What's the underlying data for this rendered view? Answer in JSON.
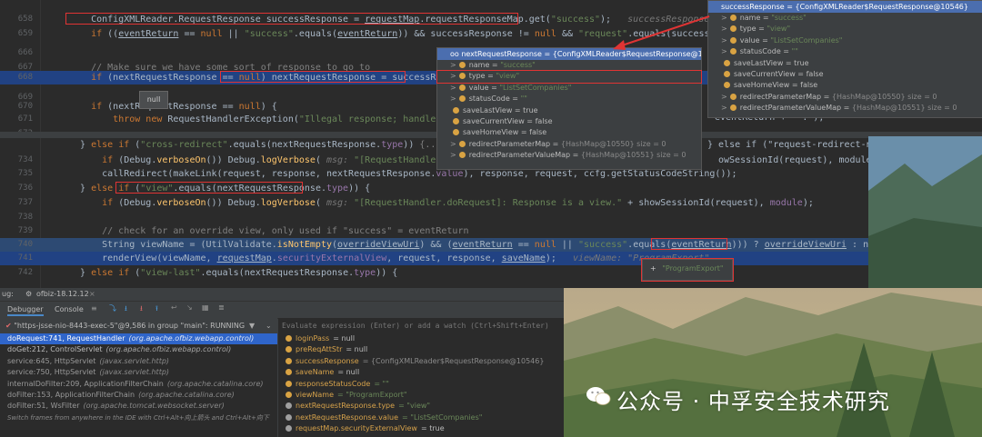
{
  "editor_top": {
    "lines": [
      {
        "n": "658",
        "segs": [
          {
            "t": "    ConfigXMLReader.RequestResponse successResponse = ",
            "c": ""
          },
          {
            "t": "requestMap",
            "c": "ul"
          },
          {
            "t": ".requestResponseMap.get(",
            "c": ""
          },
          {
            "t": "\"success\"",
            "c": "str"
          },
          {
            "t": ");",
            "c": ""
          },
          {
            "t": "   successResponse: ConfigXMLReader$Reque",
            "c": "hint"
          }
        ]
      },
      {
        "n": "659",
        "segs": [
          {
            "t": "    ",
            "c": ""
          },
          {
            "t": "if",
            "c": "kw"
          },
          {
            "t": " ((",
            "c": ""
          },
          {
            "t": "eventReturn",
            "c": "ul"
          },
          {
            "t": " == ",
            "c": ""
          },
          {
            "t": "null",
            "c": "kw"
          },
          {
            "t": " || ",
            "c": ""
          },
          {
            "t": "\"success\"",
            "c": "str"
          },
          {
            "t": ".equals(",
            "c": ""
          },
          {
            "t": "eventReturn",
            "c": "ul"
          },
          {
            "t": ")) && successResponse != ",
            "c": ""
          },
          {
            "t": "null",
            "c": "kw"
          },
          {
            "t": " && ",
            "c": ""
          },
          {
            "t": "\"request\"",
            "c": "str"
          },
          {
            "t": ".equals(successResponse.",
            "c": ""
          },
          {
            "t": "type",
            "c": "var"
          },
          {
            "t": ")) ",
            "c": ""
          },
          {
            "t": "{...}",
            "c": "cmt"
          }
        ]
      },
      {
        "n": "666",
        "segs": [
          {
            "t": "",
            "c": ""
          }
        ]
      },
      {
        "n": "667",
        "segs": [
          {
            "t": "    // Make sure we have some sort of response to go to",
            "c": "cmt"
          }
        ]
      },
      {
        "n": "668",
        "segs": [
          {
            "t": "    ",
            "c": ""
          },
          {
            "t": "if",
            "c": "kw"
          },
          {
            "t": " (nextRequestResponse == ",
            "c": ""
          },
          {
            "t": "null",
            "c": "kw"
          },
          {
            "t": ") nextRequestResponse = successResponse;",
            "c": ""
          }
        ]
      },
      {
        "n": "669",
        "segs": [
          {
            "t": "",
            "c": ""
          }
        ]
      },
      {
        "n": "670",
        "segs": [
          {
            "t": "    ",
            "c": ""
          },
          {
            "t": "if",
            "c": "kw"
          },
          {
            "t": " (nextRequestResponse == ",
            "c": ""
          },
          {
            "t": "null",
            "c": "kw"
          },
          {
            "t": ") {",
            "c": ""
          }
        ]
      },
      {
        "n": "671",
        "segs": [
          {
            "t": "        ",
            "c": ""
          },
          {
            "t": "throw new",
            "c": "kw"
          },
          {
            "t": " RequestHandlerException(",
            "c": ""
          },
          {
            "t": "\"Illegal response; handler could not pr",
            "c": "str"
          }
        ]
      },
      {
        "n": "672",
        "segs": [
          {
            "t": "",
            "c": ""
          }
        ]
      }
    ]
  },
  "editor_bottom": {
    "lines": [
      {
        "n": "",
        "segs": [
          {
            "t": "  } ",
            "c": ""
          },
          {
            "t": "else if",
            "c": "kw"
          },
          {
            "t": " (",
            "c": ""
          },
          {
            "t": "\"cross-redirect\"",
            "c": "str"
          },
          {
            "t": ".equals(nextRequestResponse.",
            "c": ""
          },
          {
            "t": "type",
            "c": "var"
          },
          {
            "t": ")) ",
            "c": ""
          },
          {
            "t": "{...}",
            "c": "cmt"
          },
          {
            "t": " ",
            "c": ""
          },
          {
            "t": "else if",
            "c": "kw"
          },
          {
            "t": " (",
            "c": ""
          }
        ]
      },
      {
        "n": "734",
        "segs": [
          {
            "t": "      ",
            "c": ""
          },
          {
            "t": "if",
            "c": "kw"
          },
          {
            "t": " (Debug.",
            "c": ""
          },
          {
            "t": "verboseOn",
            "c": "fn"
          },
          {
            "t": "()) Debug.",
            "c": ""
          },
          {
            "t": "logVerbose",
            "c": "fn"
          },
          {
            "t": "( ",
            "c": ""
          },
          {
            "t": "msg:",
            "c": "hint"
          },
          {
            "t": " \"[RequestHandler.doRequest]",
            "c": "str"
          }
        ]
      },
      {
        "n": "735",
        "segs": [
          {
            "t": "      callRedirect(makeLink(request, response, nextRequestResponse.",
            "c": ""
          },
          {
            "t": "value",
            "c": "var"
          },
          {
            "t": "), response, request, ccfg.getStatusCodeString());",
            "c": ""
          }
        ]
      },
      {
        "n": "736",
        "segs": [
          {
            "t": "  } ",
            "c": ""
          },
          {
            "t": "else if",
            "c": "kw"
          },
          {
            "t": " (",
            "c": ""
          },
          {
            "t": "\"view\"",
            "c": "str"
          },
          {
            "t": ".equals(nextRequestResponse.",
            "c": ""
          },
          {
            "t": "type",
            "c": "var"
          },
          {
            "t": ")) {",
            "c": ""
          }
        ]
      },
      {
        "n": "737",
        "segs": [
          {
            "t": "      ",
            "c": ""
          },
          {
            "t": "if",
            "c": "kw"
          },
          {
            "t": " (Debug.",
            "c": ""
          },
          {
            "t": "verboseOn",
            "c": "fn"
          },
          {
            "t": "()) Debug.",
            "c": ""
          },
          {
            "t": "logVerbose",
            "c": "fn"
          },
          {
            "t": "( ",
            "c": ""
          },
          {
            "t": "msg:",
            "c": "hint"
          },
          {
            "t": " \"[RequestHandler.doRequest]: Response is a view.\"",
            "c": "str"
          },
          {
            "t": " + showSessionId(request), ",
            "c": ""
          },
          {
            "t": "module",
            "c": "var"
          },
          {
            "t": ");",
            "c": ""
          }
        ]
      },
      {
        "n": "738",
        "segs": [
          {
            "t": "",
            "c": ""
          }
        ]
      },
      {
        "n": "739",
        "segs": [
          {
            "t": "      // check for an override view, only used if \"success\" = eventReturn",
            "c": "cmt"
          }
        ]
      },
      {
        "n": "740",
        "segs": [
          {
            "t": "      String viewName = (UtilValidate.",
            "c": ""
          },
          {
            "t": "isNotEmpty",
            "c": "fn"
          },
          {
            "t": "(",
            "c": ""
          },
          {
            "t": "overrideViewUri",
            "c": "ul"
          },
          {
            "t": ") && (",
            "c": ""
          },
          {
            "t": "eventReturn",
            "c": "ul"
          },
          {
            "t": " == ",
            "c": ""
          },
          {
            "t": "null",
            "c": "kw"
          },
          {
            "t": " || ",
            "c": ""
          },
          {
            "t": "\"success\"",
            "c": "str"
          },
          {
            "t": ".equals(",
            "c": ""
          },
          {
            "t": "eventReturn",
            "c": "ul"
          },
          {
            "t": "))) ? ",
            "c": ""
          },
          {
            "t": "overrideViewUri",
            "c": "ul"
          },
          {
            "t": " : nextRequestResponse.",
            "c": ""
          },
          {
            "t": "value",
            "c": "var"
          },
          {
            "t": ";",
            "c": ""
          }
        ]
      },
      {
        "n": "741",
        "segs": [
          {
            "t": "      renderView(viewName, ",
            "c": ""
          },
          {
            "t": "requestMap",
            "c": "ul"
          },
          {
            "t": ".",
            "c": ""
          },
          {
            "t": "securityExternalView",
            "c": "var"
          },
          {
            "t": ", request, response, ",
            "c": ""
          },
          {
            "t": "saveName",
            "c": "ul"
          },
          {
            "t": ");",
            "c": ""
          },
          {
            "t": "   viewName: \"ProgramExport\"",
            "c": "hint"
          }
        ]
      },
      {
        "n": "742",
        "segs": [
          {
            "t": "  } ",
            "c": ""
          },
          {
            "t": "else if",
            "c": "kw"
          },
          {
            "t": " (",
            "c": ""
          },
          {
            "t": "\"view-last\"",
            "c": "str"
          },
          {
            "t": ".equals(nextRequestResponse.",
            "c": ""
          },
          {
            "t": "type",
            "c": "var"
          },
          {
            "t": ")) {",
            "c": ""
          }
        ]
      }
    ],
    "right_overflow_1": "} else if (\"request-redirect-noparam",
    "right_overflow_2": "owSessionId(request), module);",
    "right_overflow_top": "eventReturn + \"\".\");"
  },
  "null_tooltip": "null",
  "popup_mid": {
    "title": "oo nextRequestResponse = {ConfigXMLReader$RequestResponse@10546}",
    "rows": [
      {
        "k": "name",
        "v": "\"success\"",
        "style": "grn",
        "arrow": ">"
      },
      {
        "k": "type",
        "v": "\"view\"",
        "style": "grn",
        "arrow": ">"
      },
      {
        "k": "value",
        "v": "\"ListSetCompanies\"",
        "style": "grn",
        "arrow": ">"
      },
      {
        "k": "statusCode",
        "v": "\"\"",
        "style": "grn",
        "arrow": ">"
      },
      {
        "k": "saveLastView",
        "v": "true",
        "style": "",
        "arrow": ""
      },
      {
        "k": "saveCurrentView",
        "v": "false",
        "style": "",
        "arrow": ""
      },
      {
        "k": "saveHomeView",
        "v": "false",
        "style": "",
        "arrow": ""
      },
      {
        "k": "redirectParameterMap",
        "v": "{HashMap@10550}  size = 0",
        "style": "dim",
        "arrow": ">"
      },
      {
        "k": "redirectParameterValueMap",
        "v": "{HashMap@10551}  size = 0",
        "style": "dim",
        "arrow": ">"
      }
    ]
  },
  "popup_right": {
    "title": "successResponse = {ConfigXMLReader$RequestResponse@10546}",
    "rows": [
      {
        "k": "name",
        "v": "\"success\"",
        "style": "grn",
        "arrow": ">"
      },
      {
        "k": "type",
        "v": "\"view\"",
        "style": "grn",
        "arrow": ">"
      },
      {
        "k": "value",
        "v": "\"ListSetCompanies\"",
        "style": "grn",
        "arrow": ">"
      },
      {
        "k": "statusCode",
        "v": "\"\"",
        "style": "grn",
        "arrow": ">"
      },
      {
        "k": "saveLastView",
        "v": "true",
        "style": "",
        "arrow": ""
      },
      {
        "k": "saveCurrentView",
        "v": "false",
        "style": "",
        "arrow": ""
      },
      {
        "k": "saveHomeView",
        "v": "false",
        "style": "",
        "arrow": ""
      },
      {
        "k": "redirectParameterMap",
        "v": "{HashMap@10550}  size = 0",
        "style": "dim",
        "arrow": ">"
      },
      {
        "k": "redirectParameterValueMap",
        "v": "{HashMap@10551}  size = 0",
        "style": "dim",
        "arrow": ">"
      }
    ]
  },
  "popup_small": {
    "value": "\"ProgramExport\""
  },
  "debug": {
    "title_prefix": "ug:",
    "run_config": "ofbiz-18.12.12",
    "tab_debugger": "Debugger",
    "tab_console": "Console",
    "thread": "\"https-jsse-nio-8443-exec-5\"@9,586 in group \"main\": RUNNING",
    "eval_placeholder": "Evaluate expression (Enter) or add a watch (Ctrl+Shift+Enter)",
    "frames": [
      {
        "t": "doRequest:741, RequestHandler",
        "p": "(org.apache.ofbiz.webapp.control)",
        "cls": "active"
      },
      {
        "t": "doGet:212, ControlServlet",
        "p": "(org.apache.ofbiz.webapp.control)",
        "cls": "user"
      },
      {
        "t": "service:645, HttpServlet",
        "p": "(javax.servlet.http)",
        "cls": ""
      },
      {
        "t": "service:750, HttpServlet",
        "p": "(javax.servlet.http)",
        "cls": ""
      },
      {
        "t": "internalDoFilter:209, ApplicationFilterChain",
        "p": "(org.apache.catalina.core)",
        "cls": ""
      },
      {
        "t": "doFilter:153, ApplicationFilterChain",
        "p": "(org.apache.catalina.core)",
        "cls": ""
      },
      {
        "t": "doFilter:51, WsFilter",
        "p": "(org.apache.tomcat.websocket.server)",
        "cls": ""
      },
      {
        "t": "Switch frames from anywhere in the IDE with Ctrl+Alt+向上箭头 and Ctrl+Alt+向下",
        "p": "",
        "cls": "hint"
      }
    ],
    "vars": [
      {
        "k": "loginPass",
        "v": "= null",
        "g": ""
      },
      {
        "k": "preReqAttStr",
        "v": "= null",
        "g": ""
      },
      {
        "k": "successResponse",
        "v": "= {ConfigXMLReader$RequestResponse@10546}",
        "g": "dim"
      },
      {
        "k": "saveName",
        "v": "= null",
        "g": ""
      },
      {
        "k": "responseStatusCode",
        "v": "= \"\"",
        "g": "grn"
      },
      {
        "k": "viewName",
        "v": "= \"ProgramExport\"",
        "g": "grn"
      },
      {
        "k": "nextRequestResponse.type",
        "v": "= \"view\"",
        "g": "grn"
      },
      {
        "k": "nextRequestResponse.value",
        "v": "= \"ListSetCompanies\"",
        "g": "grn"
      },
      {
        "k": "requestMap.securityExternalView",
        "v": "= true",
        "g": ""
      }
    ]
  },
  "watermark": "公众号 · 中孚安全技术研究",
  "colors": {
    "accent": "#4b6eaf",
    "highlight": "#e03434",
    "selected": "#2f65ca"
  }
}
